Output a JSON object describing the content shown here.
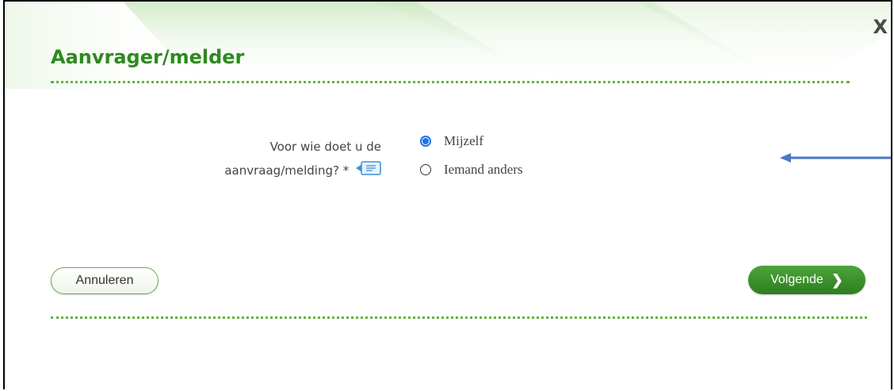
{
  "dialog": {
    "title": "Aanvrager/melder",
    "close_label": "X"
  },
  "form": {
    "question_line1": "Voor wie doet u de",
    "question_line2": "aanvraag/melding? *",
    "options": [
      {
        "label": "Mijzelf",
        "checked": true
      },
      {
        "label": "Iemand anders",
        "checked": false
      }
    ]
  },
  "buttons": {
    "cancel_label": "Annuleren",
    "next_label": "Volgende",
    "next_chevron": "❯"
  },
  "colors": {
    "title_green": "#2d8a1f",
    "button_green": "#3a9129",
    "radio_blue": "#1a73e8",
    "arrow_blue": "#4a78c4"
  }
}
